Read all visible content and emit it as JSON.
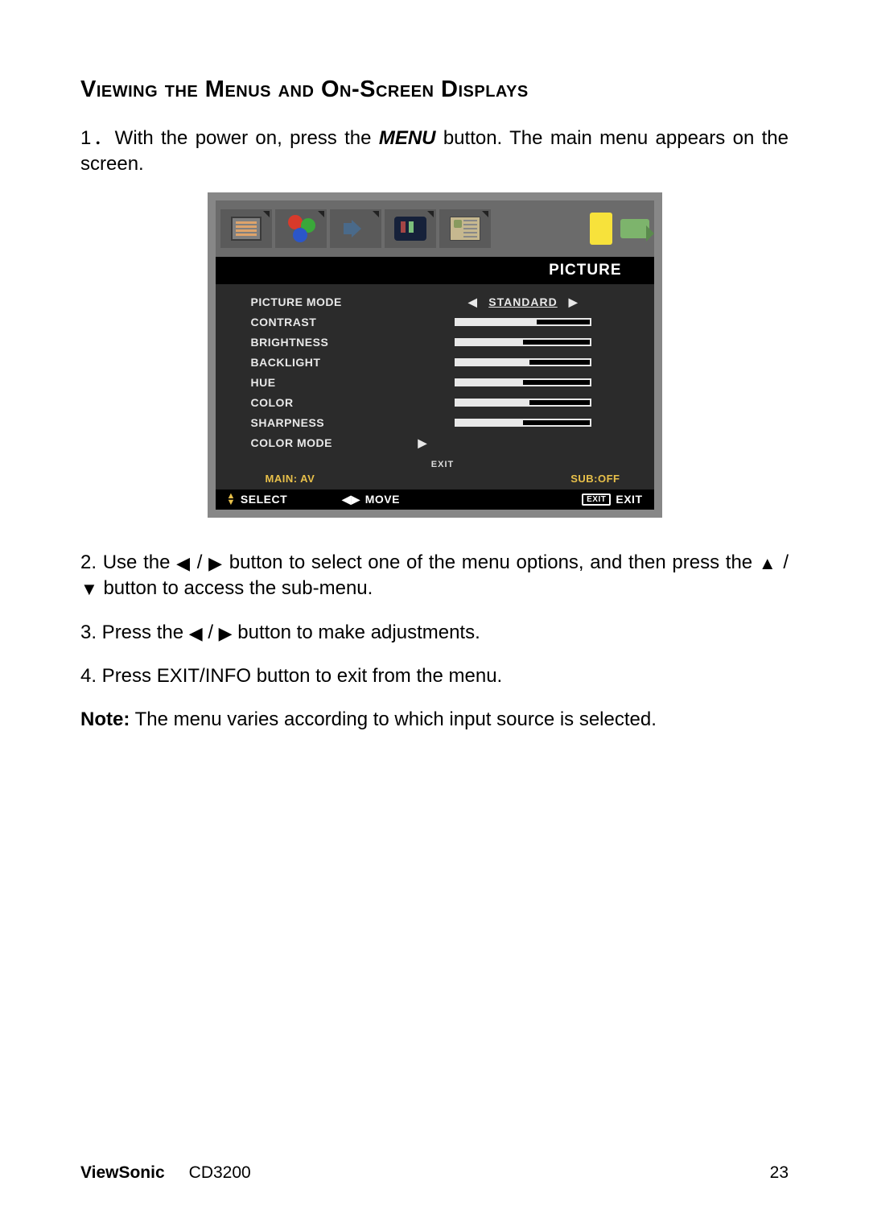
{
  "heading": "Viewing the Menus and On-Screen Displays",
  "steps": {
    "s1_a": "1．With the power on, press the ",
    "s1_menu": "MENU",
    "s1_b": " button. The main menu appears on the screen.",
    "s2_a": "2. Use the ",
    "s2_b": " button to select one of the menu options, and then press the ",
    "s2_c": " button to access the sub-menu.",
    "s3_a": "3. Press the ",
    "s3_b": "   button to make adjustments.",
    "s4": "4. Press EXIT/INFO button to exit from the menu.",
    "note_label": "Note:",
    "note_text": " The menu varies according to which input source is selected."
  },
  "glyphs": {
    "left": "◀",
    "right": "▶",
    "up": "▲",
    "down": "▼",
    "slash": " / "
  },
  "osd": {
    "title": "PICTURE",
    "rows": [
      {
        "label": "PICTURE  MODE",
        "type": "select",
        "value": "STANDARD"
      },
      {
        "label": "CONTRAST",
        "type": "slider",
        "pct": 60
      },
      {
        "label": "BRIGHTNESS",
        "type": "slider",
        "pct": 50
      },
      {
        "label": "BACKLIGHT",
        "type": "slider",
        "pct": 55
      },
      {
        "label": "HUE",
        "type": "slider",
        "pct": 50
      },
      {
        "label": "COLOR",
        "type": "slider",
        "pct": 55
      },
      {
        "label": "SHARPNESS",
        "type": "slider",
        "pct": 50
      },
      {
        "label": "COLOR MODE",
        "type": "submenu"
      }
    ],
    "exit_small": "EXIT",
    "status_left": "MAIN: AV",
    "status_right": "SUB:OFF",
    "footer": {
      "select": "SELECT",
      "move": "MOVE",
      "exit_box": "EXIT",
      "exit": "EXIT"
    }
  },
  "footer": {
    "brand": "ViewSonic",
    "model": "CD3200",
    "page": "23"
  }
}
